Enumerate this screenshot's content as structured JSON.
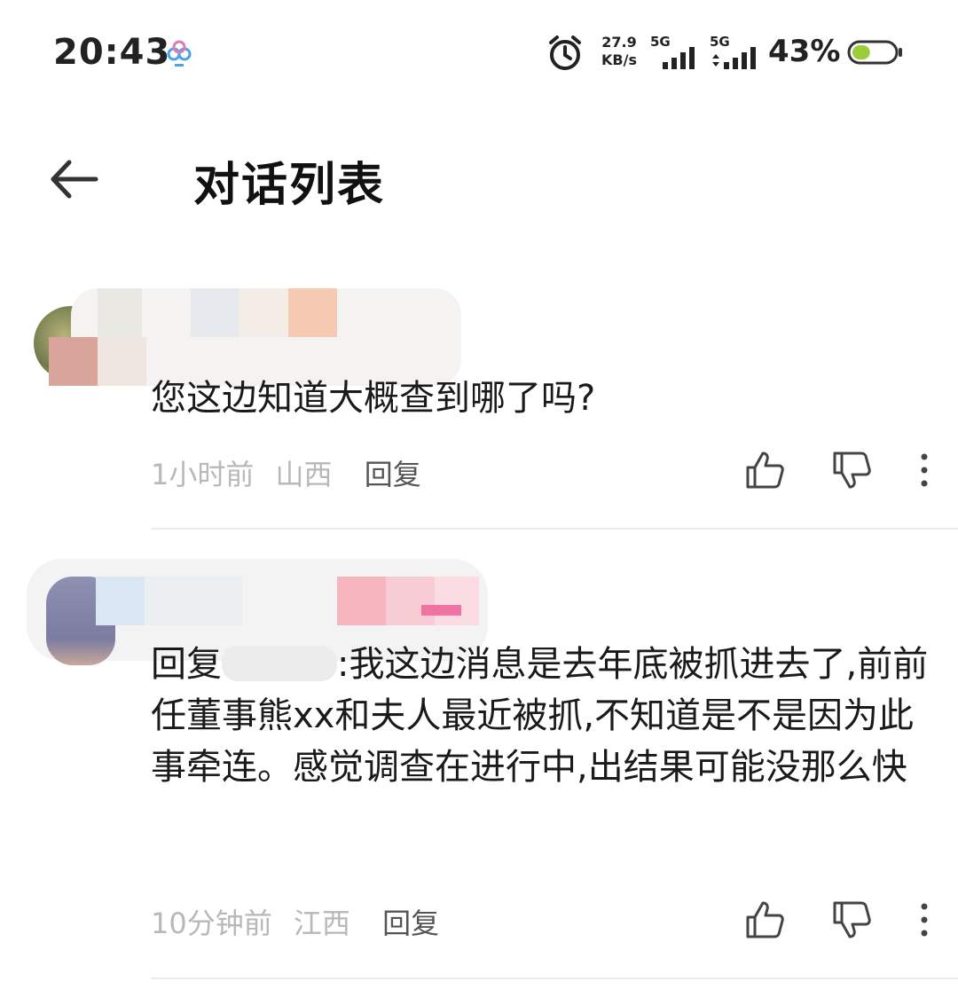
{
  "status_bar": {
    "time": "20:43",
    "net_speed_value": "27.9",
    "net_speed_unit": "KB/s",
    "sim1_label": "5G",
    "sim2_label": "5G",
    "battery_percent": "43%",
    "battery_level": 0.43,
    "icons": [
      "app-notification-icon",
      "alarm-icon",
      "signal-icon",
      "battery-icon"
    ]
  },
  "header": {
    "title": "对话列表",
    "back_icon": "back-arrow-icon"
  },
  "comments": [
    {
      "text": "您这边知道大概查到哪了吗?",
      "time": "1小时前",
      "location": "山西",
      "reply_label": "回复"
    },
    {
      "reply_prefix": "回复",
      "text": ":我这边消息是去年底被抓进去了,前前任董事熊xx和夫人最近被抓,不知道是不是因为此事牵连。感觉调查在进行中,出结果可能没那么快",
      "time": "10分钟前",
      "location": "江西",
      "reply_label": "回复"
    }
  ],
  "action_icons": [
    "thumbs-up-icon",
    "thumbs-down-icon",
    "more-icon"
  ]
}
